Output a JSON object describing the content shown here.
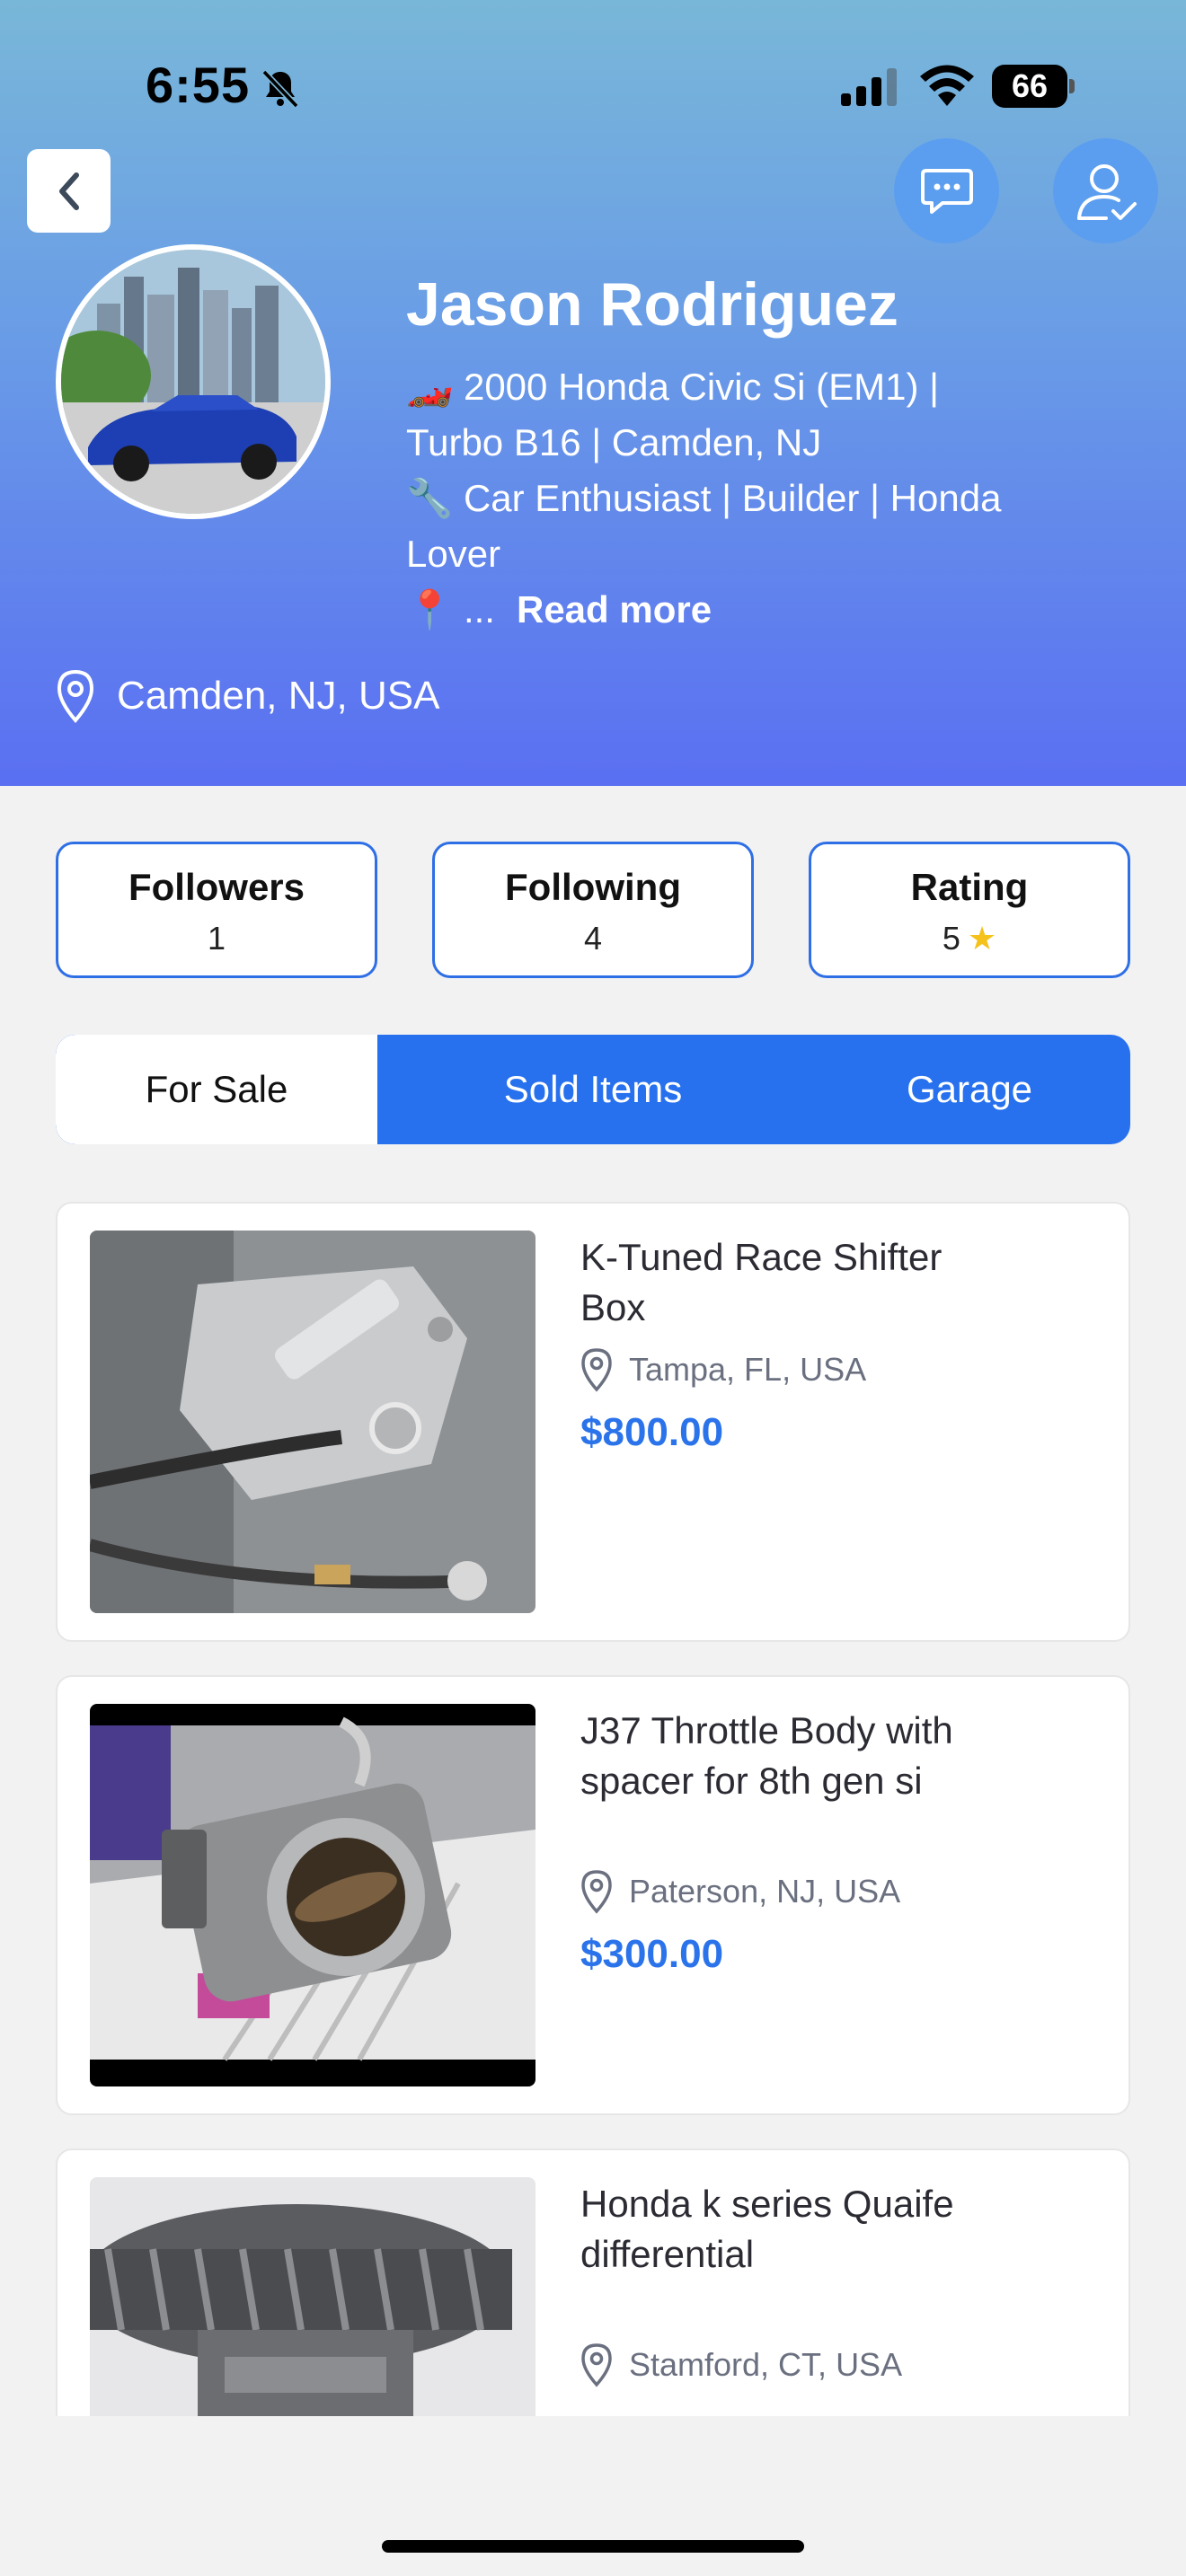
{
  "status_bar": {
    "time": "6:55",
    "battery": "66"
  },
  "profile": {
    "name": "Jason Rodriguez",
    "bio_line1": "🏎️ 2000 Honda Civic Si (EM1) |",
    "bio_line2": "Turbo B16 | Camden, NJ",
    "bio_line3": "🔧 Car Enthusiast | Builder | Honda",
    "bio_line4": "Lover",
    "bio_line5": "📍 ...",
    "read_more": "Read more",
    "location": "Camden, NJ, USA"
  },
  "stats": [
    {
      "label": "Followers",
      "value": "1"
    },
    {
      "label": "Following",
      "value": "4"
    },
    {
      "label": "Rating",
      "value": "5",
      "star": "★"
    }
  ],
  "tabs": [
    {
      "label": "For Sale",
      "active": true
    },
    {
      "label": "Sold Items",
      "active": false
    },
    {
      "label": "Garage",
      "active": false
    }
  ],
  "listings": [
    {
      "title": "K-Tuned Race Shifter Box",
      "location": "Tampa, FL, USA",
      "price": "$800.00"
    },
    {
      "title": "J37 Throttle Body with spacer for 8th gen si",
      "location": "Paterson, NJ, USA",
      "price": "$300.00"
    },
    {
      "title": "Honda k series Quaife differential",
      "location": "Stamford, CT, USA",
      "price": ""
    }
  ],
  "colors": {
    "accent": "#2771ef",
    "price": "#2b73ea",
    "header_top": "#79b7d8",
    "header_bottom": "#5a6ff2"
  },
  "icons": [
    "bell-slash-icon",
    "signal-icon",
    "wifi-icon",
    "battery-icon",
    "back-chevron-icon",
    "message-icon",
    "user-check-icon",
    "location-pin-icon",
    "star-icon"
  ]
}
